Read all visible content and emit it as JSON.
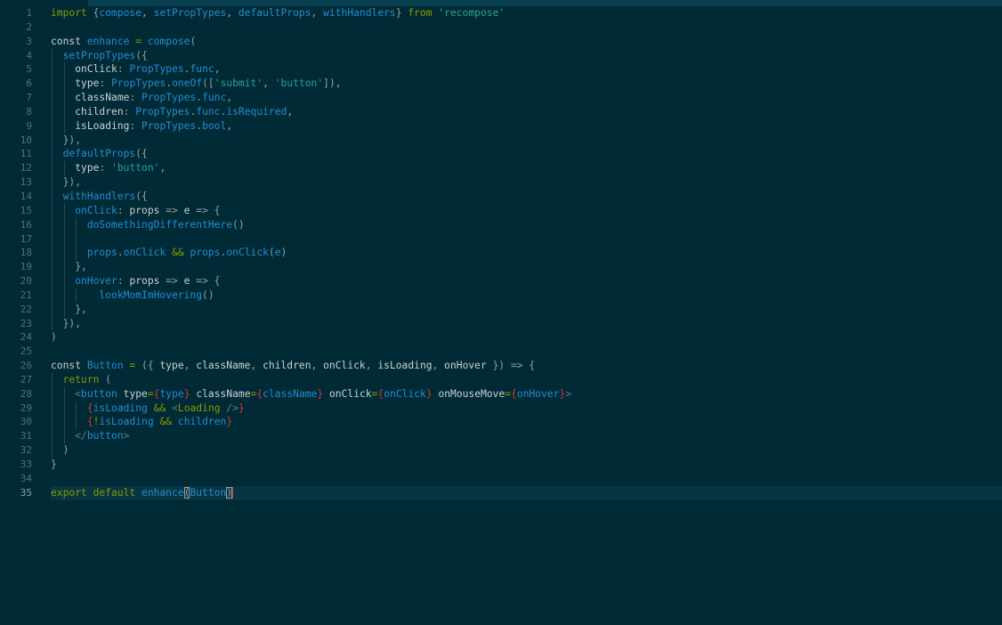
{
  "editor": {
    "current_line": 35,
    "cursor": {
      "line": 35,
      "after_token": "Button)"
    },
    "colors": {
      "background": "#002b36",
      "current_line": "#073642",
      "keyword": "#859900",
      "identifier": "#268bd2",
      "string": "#2aa198",
      "jsx_brace": "#dc322f",
      "cursor": "#dc322f"
    },
    "lines": [
      {
        "n": "1",
        "indent": 0,
        "tokens": [
          [
            "kw",
            "import"
          ],
          [
            "pn",
            " {"
          ],
          [
            "fn",
            "compose"
          ],
          [
            "pn",
            ", "
          ],
          [
            "fn",
            "setPropTypes"
          ],
          [
            "pn",
            ", "
          ],
          [
            "fn",
            "defaultProps"
          ],
          [
            "pn",
            ", "
          ],
          [
            "fn",
            "withHandlers"
          ],
          [
            "pn",
            "} "
          ],
          [
            "kw",
            "from"
          ],
          [
            "pn",
            " "
          ],
          [
            "str",
            "'recompose'"
          ]
        ]
      },
      {
        "n": "2",
        "indent": 0,
        "tokens": []
      },
      {
        "n": "3",
        "indent": 0,
        "tokens": [
          [
            "plain",
            "const "
          ],
          [
            "fn",
            "enhance"
          ],
          [
            "op",
            " = "
          ],
          [
            "fn",
            "compose"
          ],
          [
            "pn",
            "("
          ]
        ]
      },
      {
        "n": "4",
        "indent": 1,
        "tokens": [
          [
            "fn",
            "setPropTypes"
          ],
          [
            "pn",
            "({"
          ]
        ]
      },
      {
        "n": "5",
        "indent": 2,
        "tokens": [
          [
            "plain",
            "onClick"
          ],
          [
            "pn",
            ": "
          ],
          [
            "fn",
            "PropTypes"
          ],
          [
            "pn",
            "."
          ],
          [
            "fn",
            "func"
          ],
          [
            "pn",
            ","
          ]
        ]
      },
      {
        "n": "6",
        "indent": 2,
        "tokens": [
          [
            "plain",
            "type"
          ],
          [
            "pn",
            ": "
          ],
          [
            "fn",
            "PropTypes"
          ],
          [
            "pn",
            "."
          ],
          [
            "fn",
            "oneOf"
          ],
          [
            "pn",
            "(["
          ],
          [
            "str",
            "'submit'"
          ],
          [
            "pn",
            ", "
          ],
          [
            "str",
            "'button'"
          ],
          [
            "pn",
            "]),"
          ]
        ]
      },
      {
        "n": "7",
        "indent": 2,
        "tokens": [
          [
            "plain",
            "className"
          ],
          [
            "pn",
            ": "
          ],
          [
            "fn",
            "PropTypes"
          ],
          [
            "pn",
            "."
          ],
          [
            "fn",
            "func"
          ],
          [
            "pn",
            ","
          ]
        ]
      },
      {
        "n": "8",
        "indent": 2,
        "tokens": [
          [
            "plain",
            "children"
          ],
          [
            "pn",
            ": "
          ],
          [
            "fn",
            "PropTypes"
          ],
          [
            "pn",
            "."
          ],
          [
            "fn",
            "func"
          ],
          [
            "pn",
            "."
          ],
          [
            "fn",
            "isRequired"
          ],
          [
            "pn",
            ","
          ]
        ]
      },
      {
        "n": "9",
        "indent": 2,
        "tokens": [
          [
            "plain",
            "isLoading"
          ],
          [
            "pn",
            ": "
          ],
          [
            "fn",
            "PropTypes"
          ],
          [
            "pn",
            "."
          ],
          [
            "fn",
            "bool"
          ],
          [
            "pn",
            ","
          ]
        ]
      },
      {
        "n": "10",
        "indent": 1,
        "tokens": [
          [
            "pn",
            "}),"
          ]
        ]
      },
      {
        "n": "11",
        "indent": 1,
        "tokens": [
          [
            "fn",
            "defaultProps"
          ],
          [
            "pn",
            "({"
          ]
        ]
      },
      {
        "n": "12",
        "indent": 2,
        "tokens": [
          [
            "plain",
            "type"
          ],
          [
            "pn",
            ": "
          ],
          [
            "str",
            "'button'"
          ],
          [
            "pn",
            ","
          ]
        ]
      },
      {
        "n": "13",
        "indent": 1,
        "tokens": [
          [
            "pn",
            "}),"
          ]
        ]
      },
      {
        "n": "14",
        "indent": 1,
        "tokens": [
          [
            "fn",
            "withHandlers"
          ],
          [
            "pn",
            "({"
          ]
        ]
      },
      {
        "n": "15",
        "indent": 2,
        "tokens": [
          [
            "fn",
            "onClick"
          ],
          [
            "pn",
            ": "
          ],
          [
            "plain",
            "props "
          ],
          [
            "pn",
            "=> "
          ],
          [
            "plain",
            "e "
          ],
          [
            "pn",
            "=> {"
          ]
        ]
      },
      {
        "n": "16",
        "indent": 3,
        "tokens": [
          [
            "fn",
            "doSomethingDifferentHere"
          ],
          [
            "pn",
            "()"
          ]
        ]
      },
      {
        "n": "17",
        "indent": 3,
        "tokens": []
      },
      {
        "n": "18",
        "indent": 3,
        "tokens": [
          [
            "fn",
            "props"
          ],
          [
            "pn",
            "."
          ],
          [
            "fn",
            "onClick"
          ],
          [
            "pn",
            " "
          ],
          [
            "kw",
            "&&"
          ],
          [
            "pn",
            " "
          ],
          [
            "fn",
            "props"
          ],
          [
            "pn",
            "."
          ],
          [
            "fn",
            "onClick"
          ],
          [
            "pn",
            "("
          ],
          [
            "fn",
            "e"
          ],
          [
            "pn",
            ")"
          ]
        ]
      },
      {
        "n": "19",
        "indent": 2,
        "tokens": [
          [
            "pn",
            "},"
          ]
        ]
      },
      {
        "n": "20",
        "indent": 2,
        "tokens": [
          [
            "fn",
            "onHover"
          ],
          [
            "pn",
            ": "
          ],
          [
            "plain",
            "props "
          ],
          [
            "pn",
            "=> "
          ],
          [
            "plain",
            "e "
          ],
          [
            "pn",
            "=> {"
          ]
        ]
      },
      {
        "n": "21",
        "indent": 4,
        "tokens": [
          [
            "fn",
            "lookMomImHovering"
          ],
          [
            "pn",
            "()"
          ]
        ]
      },
      {
        "n": "22",
        "indent": 2,
        "tokens": [
          [
            "pn",
            "},"
          ]
        ]
      },
      {
        "n": "23",
        "indent": 1,
        "tokens": [
          [
            "pn",
            "}),"
          ]
        ]
      },
      {
        "n": "24",
        "indent": 0,
        "tokens": [
          [
            "pn",
            ")"
          ]
        ]
      },
      {
        "n": "25",
        "indent": 0,
        "tokens": []
      },
      {
        "n": "26",
        "indent": 0,
        "tokens": [
          [
            "plain",
            "const "
          ],
          [
            "fn",
            "Button"
          ],
          [
            "op",
            " = "
          ],
          [
            "pn",
            "({ "
          ],
          [
            "plain",
            "type"
          ],
          [
            "pn",
            ", "
          ],
          [
            "plain",
            "className"
          ],
          [
            "pn",
            ", "
          ],
          [
            "plain",
            "children"
          ],
          [
            "pn",
            ", "
          ],
          [
            "plain",
            "onClick"
          ],
          [
            "pn",
            ", "
          ],
          [
            "plain",
            "isLoading"
          ],
          [
            "pn",
            ", "
          ],
          [
            "plain",
            "onHover"
          ],
          [
            "pn",
            " }) => {"
          ]
        ]
      },
      {
        "n": "27",
        "indent": 1,
        "tokens": [
          [
            "kw",
            "return"
          ],
          [
            "pn",
            " ("
          ]
        ]
      },
      {
        "n": "28",
        "indent": 2,
        "tokens": [
          [
            "tagp",
            "<"
          ],
          [
            "tag",
            "button"
          ],
          [
            "plain",
            " type"
          ],
          [
            "op",
            "="
          ],
          [
            "br",
            "{"
          ],
          [
            "fn",
            "type"
          ],
          [
            "br",
            "}"
          ],
          [
            "plain",
            " className"
          ],
          [
            "op",
            "="
          ],
          [
            "br",
            "{"
          ],
          [
            "fn",
            "className"
          ],
          [
            "br",
            "}"
          ],
          [
            "plain",
            " onClick"
          ],
          [
            "op",
            "="
          ],
          [
            "br",
            "{"
          ],
          [
            "fn",
            "onClick"
          ],
          [
            "br",
            "}"
          ],
          [
            "plain",
            " onMouseMove"
          ],
          [
            "op",
            "="
          ],
          [
            "br",
            "{"
          ],
          [
            "fn",
            "onHover"
          ],
          [
            "br",
            "}"
          ],
          [
            "tagp",
            ">"
          ]
        ]
      },
      {
        "n": "29",
        "indent": 3,
        "tokens": [
          [
            "br",
            "{"
          ],
          [
            "fn",
            "isLoading"
          ],
          [
            "pn",
            " "
          ],
          [
            "kw",
            "&&"
          ],
          [
            "pn",
            " "
          ],
          [
            "tagp",
            "<"
          ],
          [
            "kw",
            "Loading"
          ],
          [
            "tagp",
            " />"
          ],
          [
            "br",
            "}"
          ]
        ]
      },
      {
        "n": "30",
        "indent": 3,
        "tokens": [
          [
            "br",
            "{"
          ],
          [
            "kw",
            "!"
          ],
          [
            "fn",
            "isLoading"
          ],
          [
            "pn",
            " "
          ],
          [
            "kw",
            "&&"
          ],
          [
            "pn",
            " "
          ],
          [
            "fn",
            "children"
          ],
          [
            "br",
            "}"
          ]
        ]
      },
      {
        "n": "31",
        "indent": 2,
        "tokens": [
          [
            "tagp",
            "</"
          ],
          [
            "tag",
            "button"
          ],
          [
            "tagp",
            ">"
          ]
        ]
      },
      {
        "n": "32",
        "indent": 1,
        "tokens": [
          [
            "pn",
            ")"
          ]
        ]
      },
      {
        "n": "33",
        "indent": 0,
        "tokens": [
          [
            "pn",
            "}"
          ]
        ]
      },
      {
        "n": "34",
        "indent": 0,
        "tokens": []
      },
      {
        "n": "35",
        "indent": 0,
        "tokens": [
          [
            "kw",
            "export"
          ],
          [
            "pn",
            " "
          ],
          [
            "kw",
            "default"
          ],
          [
            "pn",
            " "
          ],
          [
            "fn",
            "enhance"
          ],
          [
            "match",
            "("
          ],
          [
            "fn",
            "Button"
          ],
          [
            "match",
            ")"
          ]
        ]
      }
    ]
  }
}
